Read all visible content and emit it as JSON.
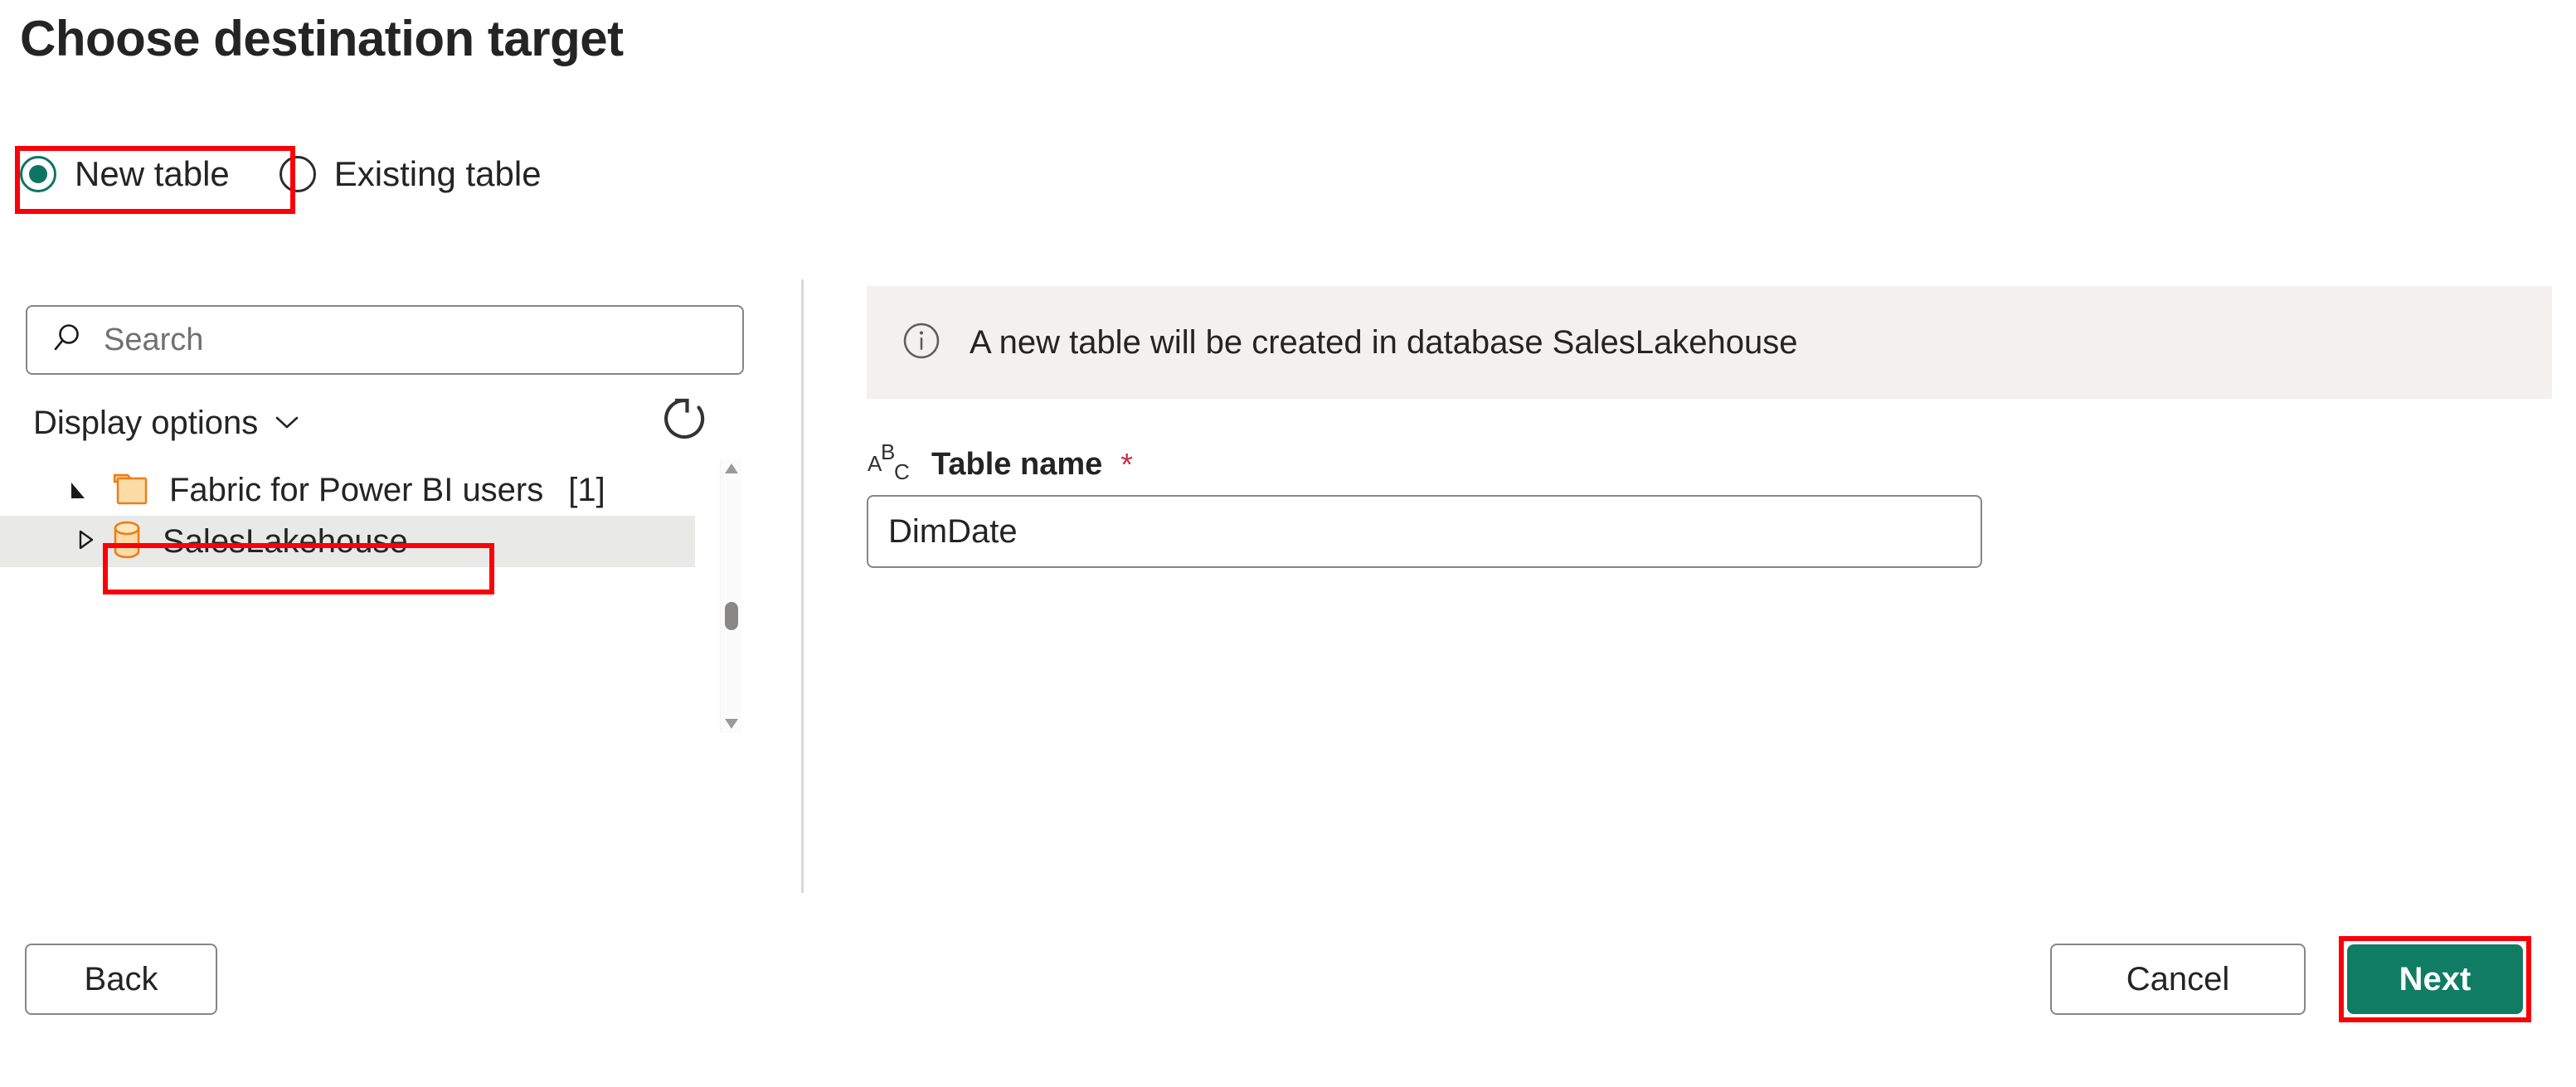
{
  "page": {
    "title": "Choose destination target"
  },
  "destination_mode": {
    "selected": "new_table",
    "options": [
      {
        "id": "new_table",
        "label": "New table",
        "checked": true
      },
      {
        "id": "existing_table",
        "label": "Existing table",
        "checked": false
      }
    ]
  },
  "left_pane": {
    "search": {
      "placeholder": "Search",
      "value": "",
      "icon": "search-icon"
    },
    "display_options": {
      "label": "Display options",
      "chevron_icon": "chevron-down-icon"
    },
    "refresh": {
      "icon": "refresh-icon",
      "title": "Refresh"
    },
    "tree": [
      {
        "label": "Fabric for Power BI users",
        "count": "[1]",
        "icon": "folder-icon",
        "expanded": true,
        "selected": false,
        "level": 0
      },
      {
        "label": "SalesLakehouse",
        "count": "",
        "icon": "database-icon",
        "expanded": false,
        "selected": true,
        "level": 1
      }
    ]
  },
  "right_pane": {
    "info": {
      "icon": "info-icon",
      "message": "A new table will be created in database SalesLakehouse"
    },
    "table_name_field": {
      "icon": "abc-text-type-icon",
      "label": "Table name",
      "required_marker": "*",
      "value": "DimDate",
      "placeholder": ""
    }
  },
  "footer": {
    "back_label": "Back",
    "cancel_label": "Cancel",
    "next_label": "Next"
  },
  "colors": {
    "accent_teal": "#107c64",
    "radio_teal": "#0f7464",
    "highlight_red": "#fb0007",
    "required_red": "#c4314b",
    "info_bar_bg": "#f2f1f0",
    "selected_row_bg": "#e9e9e7",
    "folder_orange": "#ed7d16",
    "folder_fill": "#f7cb8b",
    "text": "#242424"
  }
}
